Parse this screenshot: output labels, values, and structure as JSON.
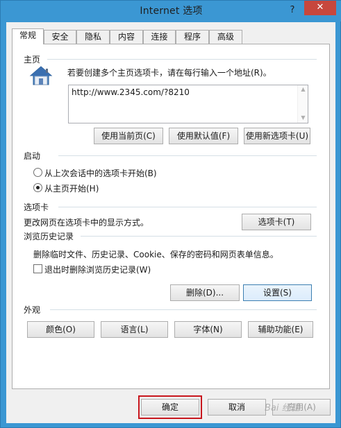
{
  "window": {
    "title": "Internet 选项",
    "help_label": "?",
    "close_label": "✕"
  },
  "tabs": [
    {
      "label": "常规",
      "active": true
    },
    {
      "label": "安全"
    },
    {
      "label": "隐私"
    },
    {
      "label": "内容"
    },
    {
      "label": "连接"
    },
    {
      "label": "程序"
    },
    {
      "label": "高级"
    }
  ],
  "homepage": {
    "section_label": "主页",
    "icon": "home-icon",
    "instruction": "若要创建多个主页选项卡，请在每行输入一个地址(R)。",
    "url": "http://www.2345.com/?8210",
    "buttons": {
      "use_current": "使用当前页(C)",
      "use_default": "使用默认值(F)",
      "use_new_tab": "使用新选项卡(U)"
    }
  },
  "startup": {
    "section_label": "启动",
    "option_last_session": "从上次会话中的选项卡开始(B)",
    "option_homepage": "从主页开始(H)",
    "selected": "homepage"
  },
  "tabs_section": {
    "section_label": "选项卡",
    "description": "更改网页在选项卡中的显示方式。",
    "button": "选项卡(T)"
  },
  "history": {
    "section_label": "浏览历史记录",
    "description": "删除临时文件、历史记录、Cookie、保存的密码和网页表单信息。",
    "checkbox_label": "退出时删除浏览历史记录(W)",
    "checked": false,
    "delete_button": "删除(D)...",
    "settings_button": "设置(S)"
  },
  "appearance": {
    "section_label": "外观",
    "colors_button": "颜色(O)",
    "languages_button": "语言(L)",
    "fonts_button": "字体(N)",
    "accessibility_button": "辅助功能(E)"
  },
  "footer": {
    "ok_button": "确定",
    "cancel_button": "取消",
    "apply_button": "应用(A)"
  },
  "watermark": "Bai 经验",
  "colors": {
    "titlebar": "#3b97d3",
    "close": "#c7473d",
    "highlight": "#c8161d"
  }
}
